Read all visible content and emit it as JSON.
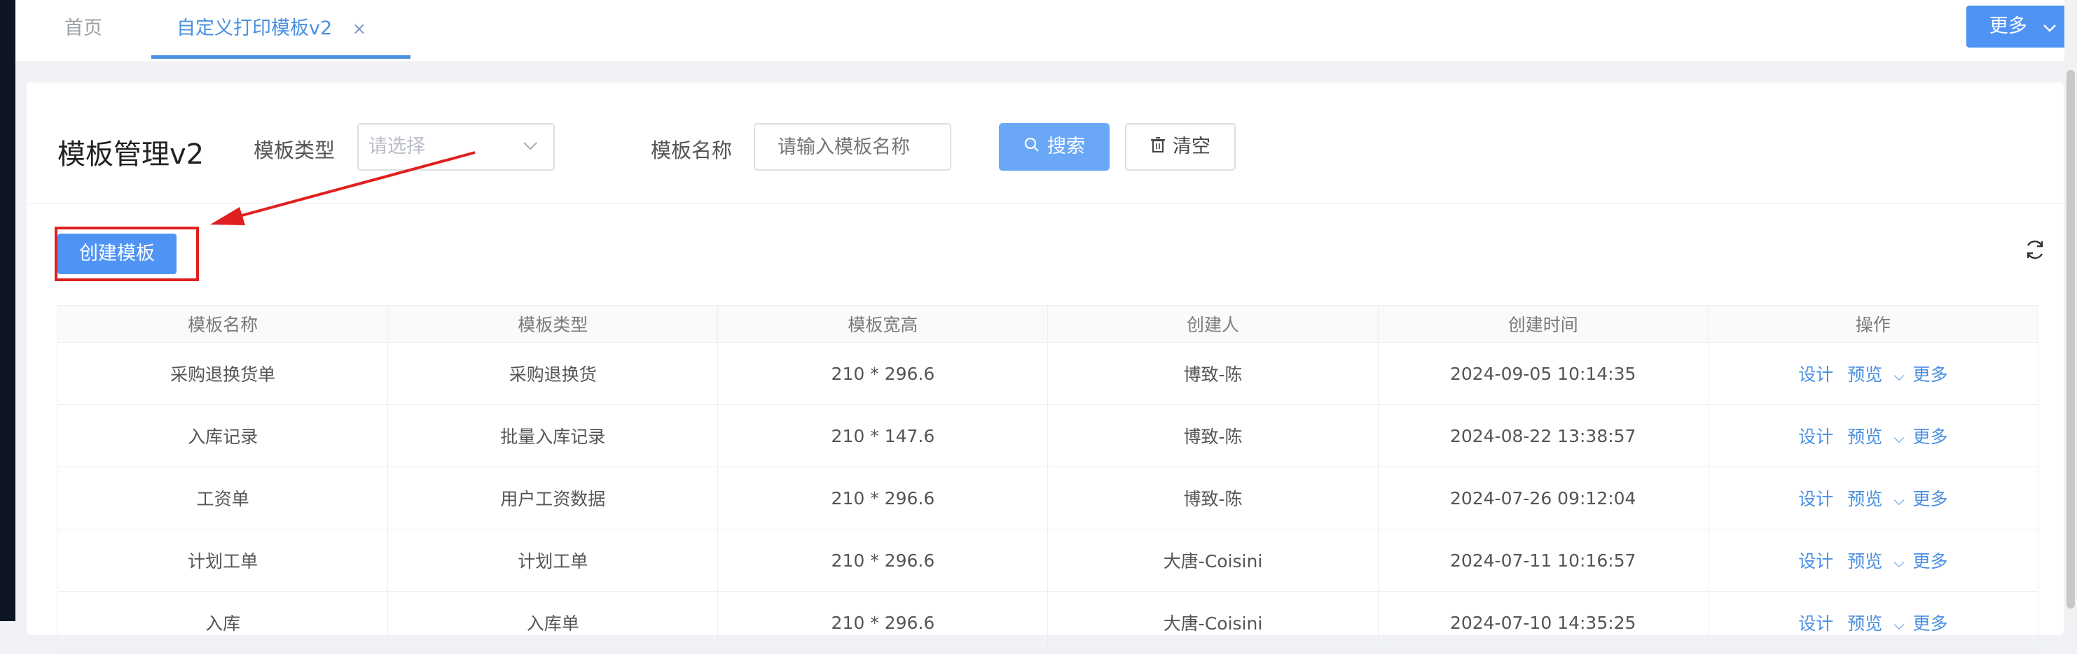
{
  "tabs": {
    "home_label": "首页",
    "active_label": "自定义打印模板v2",
    "close_glyph": "×"
  },
  "more_button_label": "更多",
  "page": {
    "title": "模板管理v2",
    "filter_type_label": "模板类型",
    "filter_type_placeholder": "请选择",
    "filter_name_label": "模板名称",
    "filter_name_placeholder": "请输入模板名称",
    "search_label": "搜索",
    "clear_label": "清空",
    "create_label": "创建模板"
  },
  "table": {
    "headers": [
      "模板名称",
      "模板类型",
      "模板宽高",
      "创建人",
      "创建时间",
      "操作"
    ],
    "rows": [
      [
        "采购退换货单",
        "采购退换货",
        "210 * 296.6",
        "博致-陈",
        "2024-09-05 10:14:35"
      ],
      [
        "入库记录",
        "批量入库记录",
        "210 * 147.6",
        "博致-陈",
        "2024-08-22 13:38:57"
      ],
      [
        "工资单",
        "用户工资数据",
        "210 * 296.6",
        "博致-陈",
        "2024-07-26 09:12:04"
      ],
      [
        "计划工单",
        "计划工单",
        "210 * 296.6",
        "大唐-Coisini",
        "2024-07-11 10:16:57"
      ],
      [
        "入库",
        "入库单",
        "210 * 296.6",
        "大唐-Coisini",
        "2024-07-10 14:35:25"
      ]
    ],
    "actions": {
      "design": "设计",
      "preview": "预览",
      "more": "更多"
    }
  },
  "colors": {
    "accent": "#4f94f5",
    "link": "#4a90e2",
    "annotation": "#e02020"
  },
  "icons": [
    "search-icon",
    "trash-icon",
    "chevron-down-icon",
    "refresh-icon",
    "close-icon"
  ]
}
